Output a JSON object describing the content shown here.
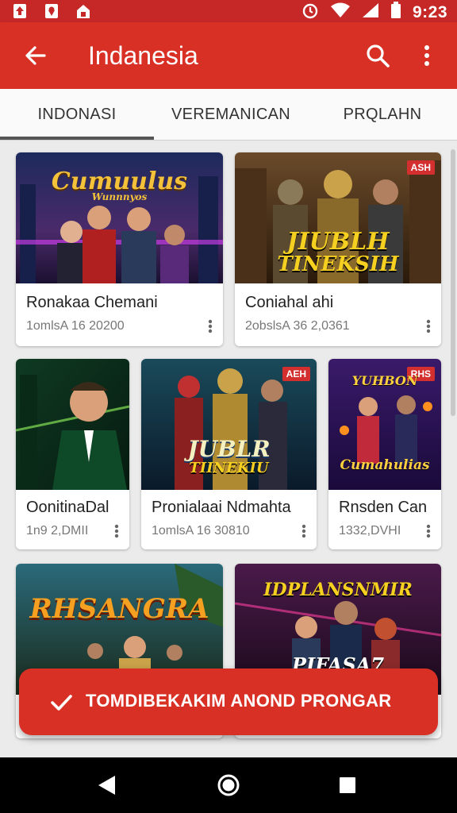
{
  "status_bar": {
    "time": "9:23"
  },
  "app_bar": {
    "title": "Indanesia"
  },
  "tabs": [
    {
      "label": "INDONASI",
      "selected": true
    },
    {
      "label": "VEREMANICAN",
      "selected": false
    },
    {
      "label": "PRQLAHN",
      "selected": false
    }
  ],
  "cards": [
    {
      "title": "Ronakaa Chemani",
      "meta": "1omlsA  16 20200",
      "badge": "",
      "art_text": "Cumuulus",
      "art_sub": "Wunnnyos"
    },
    {
      "title": "Coniahal ahi",
      "meta": "2obslsA  36 2,0361",
      "badge": "ASH",
      "art_text": "JIUBLH",
      "art_sub": "TINEKSIH"
    },
    {
      "title": "OonitinaDal",
      "meta": "1n9 2,DMII",
      "badge": "",
      "art_text": "",
      "art_sub": ""
    },
    {
      "title": "Pronialaai Ndmahta",
      "meta": "1omlsA  16 30810",
      "badge": "AEH",
      "art_text": "JUBLR",
      "art_sub": "TIINEKIU"
    },
    {
      "title": "Rnsden Can",
      "meta": "1332,DVHI",
      "badge": "RHS",
      "art_text": "YUHBON",
      "art_sub": "Cumahulias"
    },
    {
      "title": "",
      "meta": "",
      "badge": "",
      "art_text": "RHSANGRA",
      "art_sub": ""
    },
    {
      "title": "",
      "meta": "",
      "badge": "",
      "art_text": "IDPLANSNMIR",
      "art_sub": "PIFASA7"
    }
  ],
  "snackbar": {
    "text": "TOMDIBEKAKIM ANOND PRONGAR"
  },
  "colors": {
    "primary": "#d93025",
    "status_bar": "#c62828"
  }
}
